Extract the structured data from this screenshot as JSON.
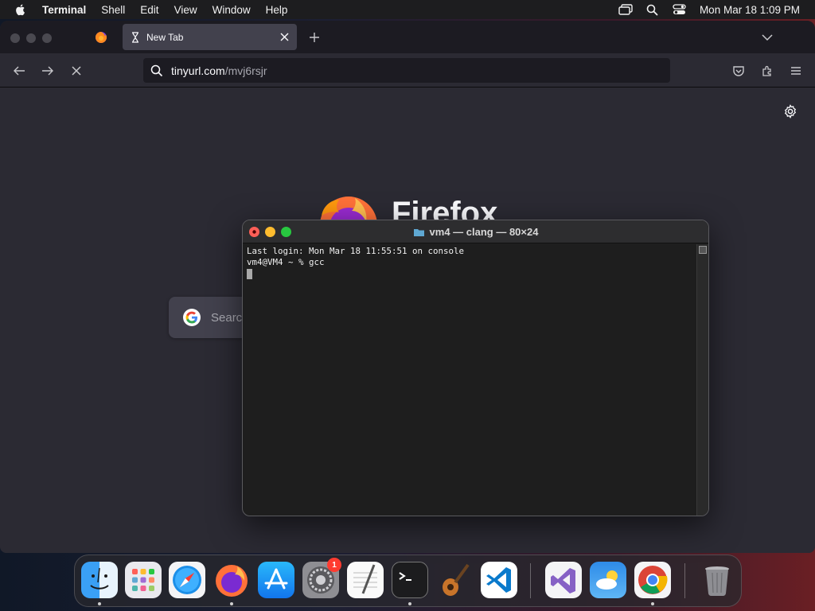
{
  "menubar": {
    "app_name": "Terminal",
    "items": [
      "Shell",
      "Edit",
      "View",
      "Window",
      "Help"
    ],
    "clock": "Mon Mar 18  1:09 PM"
  },
  "firefox": {
    "active_tab": {
      "title": "New Tab"
    },
    "url": {
      "host": "tinyurl.com",
      "path": "/mvj6rsjr"
    },
    "search_placeholder": "Search",
    "wordmark": "Firefox"
  },
  "terminal": {
    "title": "vm4 — clang — 80×24",
    "lines": [
      "Last login: Mon Mar 18 11:55:51 on console",
      "vm4@VM4 ~ % gcc"
    ]
  },
  "dock": {
    "apps": [
      {
        "name": "Finder",
        "icon": "finder-icon",
        "running": true
      },
      {
        "name": "Launchpad",
        "icon": "launchpad-icon",
        "running": false
      },
      {
        "name": "Safari",
        "icon": "safari-icon",
        "running": false
      },
      {
        "name": "Firefox",
        "icon": "firefox-icon",
        "running": true
      },
      {
        "name": "App Store",
        "icon": "app-store-icon",
        "running": false
      },
      {
        "name": "System Settings",
        "icon": "system-settings-icon",
        "running": false,
        "badge": "1"
      },
      {
        "name": "TextEdit",
        "icon": "textedit-icon",
        "running": false
      },
      {
        "name": "Terminal",
        "icon": "terminal-icon",
        "running": true
      },
      {
        "name": "GarageBand",
        "icon": "garageband-icon",
        "running": false
      },
      {
        "name": "Visual Studio Code",
        "icon": "vscode-icon",
        "running": false
      },
      {
        "name": "Visual Studio",
        "icon": "visual-studio-icon",
        "running": false
      },
      {
        "name": "Weather",
        "icon": "weather-icon",
        "running": false
      },
      {
        "name": "Google Chrome",
        "icon": "chrome-icon",
        "running": true
      },
      {
        "name": "Trash",
        "icon": "trash-icon",
        "running": false
      }
    ]
  }
}
